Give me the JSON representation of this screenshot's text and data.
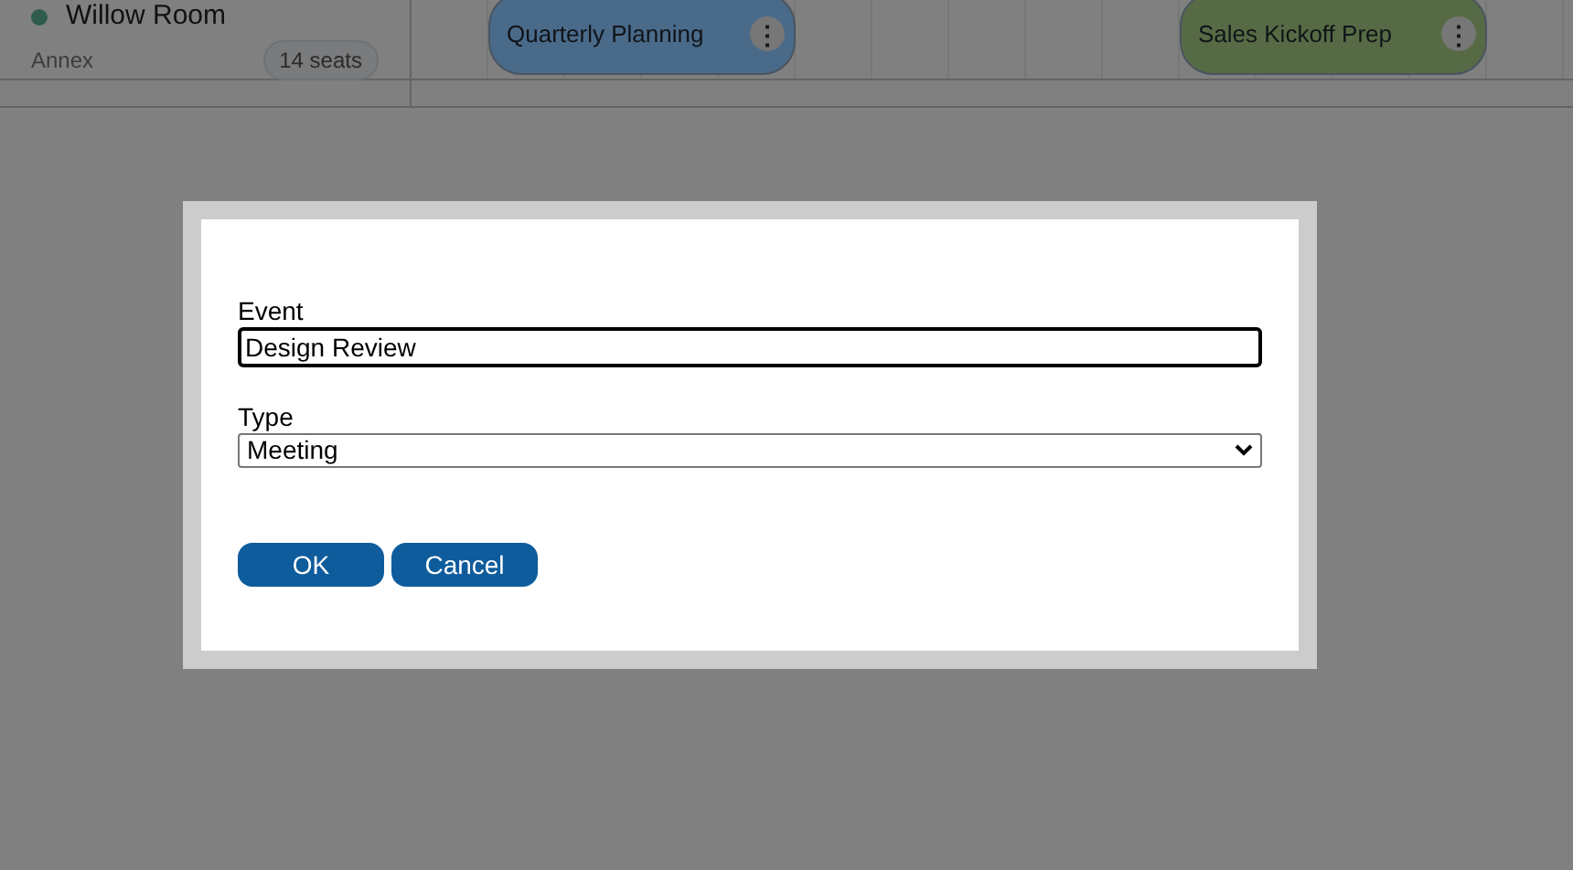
{
  "resource": {
    "name": "Willow Room",
    "location": "Annex",
    "capacity": "14 seats",
    "color": "#2f5c4d"
  },
  "events": [
    {
      "title": "Quarterly Planning",
      "color": "#4a6a8a",
      "menu_icon": "⋮"
    },
    {
      "title": "Sales Kickoff Prep",
      "color": "#566b45",
      "menu_icon": "⋮"
    }
  ],
  "dialog": {
    "fields": [
      {
        "kind": "text",
        "label": "Event",
        "value": "Design Review"
      },
      {
        "kind": "select",
        "label": "Type",
        "value": "Meeting"
      }
    ],
    "buttons": [
      "OK",
      "Cancel"
    ]
  }
}
